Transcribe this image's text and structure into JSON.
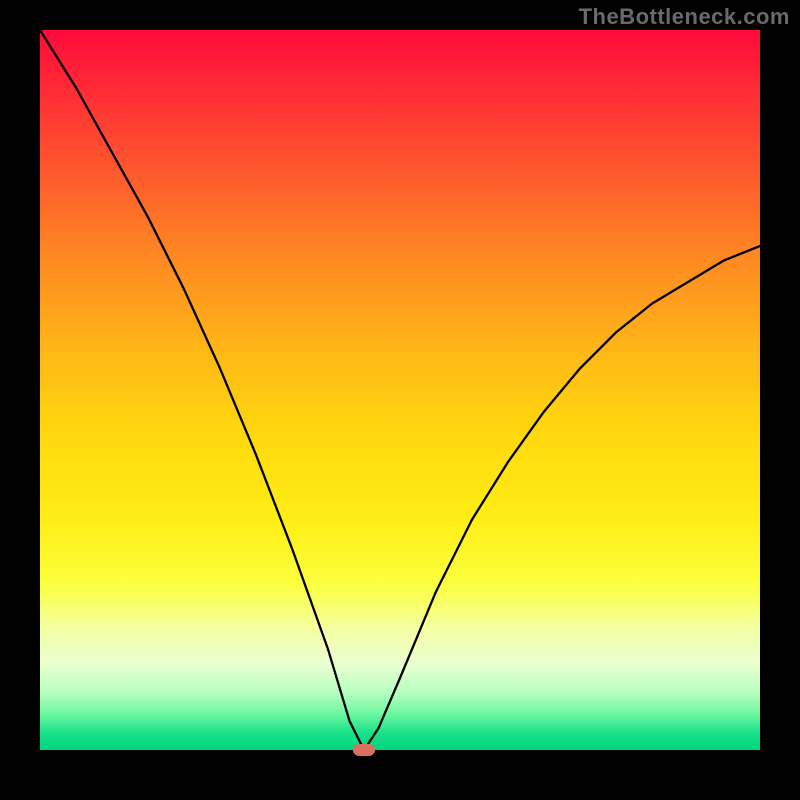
{
  "watermark": "TheBottleneck.com",
  "chart_data": {
    "type": "line",
    "title": "",
    "xlabel": "",
    "ylabel": "",
    "xlim": [
      0,
      100
    ],
    "ylim": [
      0,
      100
    ],
    "grid": false,
    "legend": false,
    "series": [
      {
        "name": "bottleneck-curve",
        "x": [
          0,
          5,
          10,
          15,
          20,
          25,
          30,
          35,
          40,
          43,
          45,
          47,
          50,
          55,
          60,
          65,
          70,
          75,
          80,
          85,
          90,
          95,
          100
        ],
        "y": [
          100,
          92,
          83,
          74,
          64,
          53,
          41,
          28,
          14,
          4,
          0,
          3,
          10,
          22,
          32,
          40,
          47,
          53,
          58,
          62,
          65,
          68,
          70
        ]
      }
    ],
    "nadir": {
      "x": 45,
      "y": 0
    },
    "background_gradient": {
      "top": "#ff0a3c",
      "mid": "#ffee14",
      "bottom": "#00d47e"
    }
  }
}
